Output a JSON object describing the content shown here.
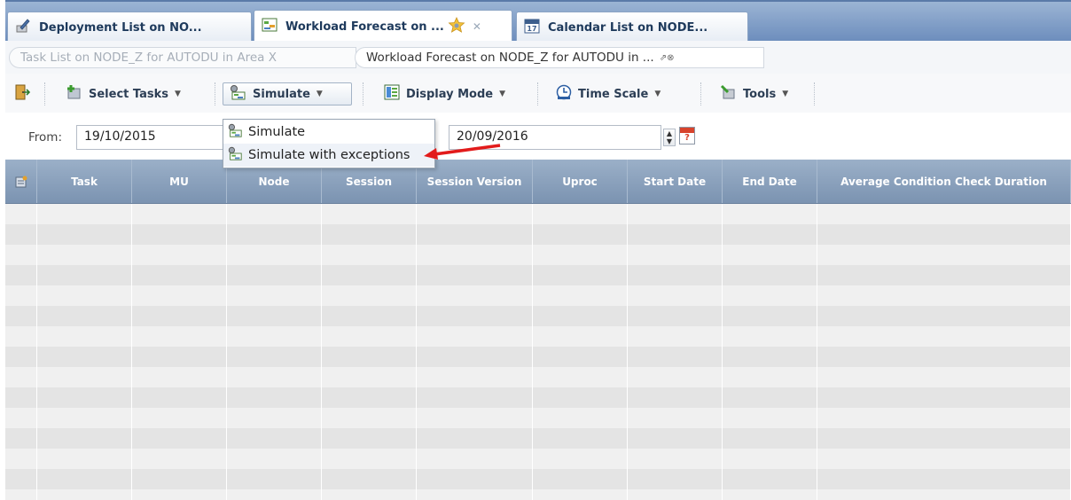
{
  "tabs": [
    {
      "label": "Deployment List on NO...",
      "icon": "pencil-document-icon",
      "active": false
    },
    {
      "label": "Workload Forecast on ...",
      "icon": "workload-forecast-icon",
      "active": true,
      "extra_icon": "star-gear-icon"
    },
    {
      "label": "Calendar List on NODE...",
      "icon": "calendar-icon",
      "active": false
    }
  ],
  "breadcrumbs": [
    {
      "label": "Task List on NODE_Z for AUTODU in Area X"
    },
    {
      "label": "Workload Forecast on NODE_Z for AUTODU in ..."
    }
  ],
  "toolbar": {
    "exit_icon": "exit-door-icon",
    "select_tasks": "Select Tasks",
    "simulate": "Simulate",
    "display_mode": "Display Mode",
    "time_scale": "Time Scale",
    "tools": "Tools"
  },
  "filter": {
    "from_label": "From:",
    "from_value": "19/10/2015",
    "to_value": "20/09/2016"
  },
  "simulate_menu": {
    "items": [
      "Simulate",
      "Simulate with exceptions"
    ],
    "highlighted_index": 1
  },
  "grid": {
    "columns": [
      "Task",
      "MU",
      "Node",
      "Session",
      "Session Version",
      "Uproc",
      "Start Date",
      "End Date",
      "Average Condition Check Duration"
    ],
    "rows": []
  },
  "colors": {
    "header_bg": "#7b93b1",
    "row_odd": "#f0f0f0",
    "row_even": "#e4e4e4",
    "annotation_arrow": "#e21b1b"
  }
}
